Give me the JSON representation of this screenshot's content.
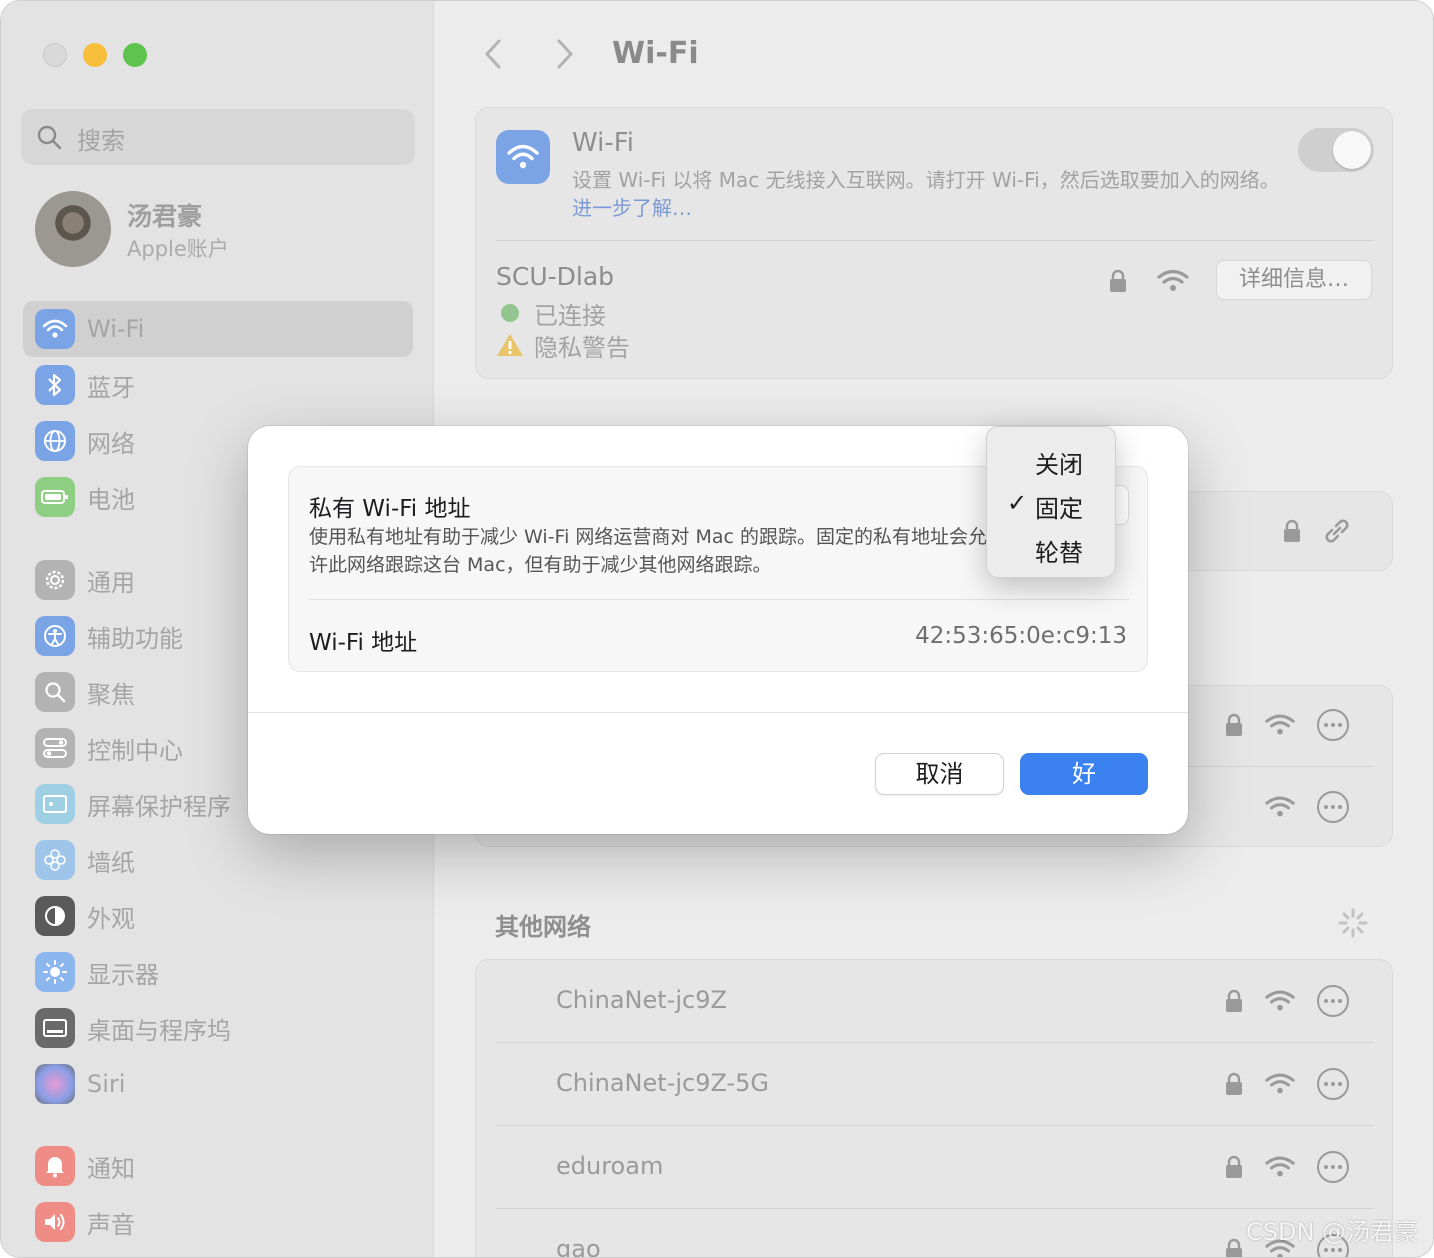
{
  "sidebar": {
    "search_placeholder": "搜索",
    "profile": {
      "name": "汤君豪",
      "sub": "Apple账户"
    },
    "items": [
      {
        "label": "Wi-Fi",
        "icon": "wifi-icon",
        "color": "#7aa4e6",
        "selected": true
      },
      {
        "label": "蓝牙",
        "icon": "bluetooth-icon",
        "color": "#7aa4e6"
      },
      {
        "label": "网络",
        "icon": "globe-icon",
        "color": "#7aa4e6"
      },
      {
        "label": "电池",
        "icon": "battery-icon",
        "color": "#8fcf84"
      },
      {
        "label": "通用",
        "icon": "gear-icon",
        "color": "#b3b3b3"
      },
      {
        "label": "辅助功能",
        "icon": "accessibility-icon",
        "color": "#7aa4e6"
      },
      {
        "label": "聚焦",
        "icon": "spotlight-icon",
        "color": "#b3b3b3"
      },
      {
        "label": "控制中心",
        "icon": "control-center-icon",
        "color": "#b3b3b3"
      },
      {
        "label": "屏幕保护程序",
        "icon": "screensaver-icon",
        "color": "#9fcfe4"
      },
      {
        "label": "墙纸",
        "icon": "wallpaper-icon",
        "color": "#9fc6ea"
      },
      {
        "label": "外观",
        "icon": "appearance-icon",
        "color": "#5a5a5a"
      },
      {
        "label": "显示器",
        "icon": "display-icon",
        "color": "#8bb6ee"
      },
      {
        "label": "桌面与程序坞",
        "icon": "dock-icon",
        "color": "#6a6a6a"
      },
      {
        "label": "Siri",
        "icon": "siri-icon",
        "color": "#a88fd6"
      },
      {
        "label": "通知",
        "icon": "bell-icon",
        "color": "#f08c86"
      },
      {
        "label": "声音",
        "icon": "speaker-icon",
        "color": "#f08c86"
      }
    ]
  },
  "main": {
    "title": "Wi-Fi",
    "wifi_card": {
      "title": "Wi-Fi",
      "desc": "设置 Wi-Fi 以将 Mac 无线接入互联网。请打开 Wi-Fi，然后选取要加入的网络。",
      "link": "进一步了解…"
    },
    "current_network": {
      "name": "SCU-Dlab",
      "status": "已连接",
      "warning": "隐私警告",
      "details_button": "详细信息…"
    },
    "other_networks_title": "其他网络",
    "other_networks": [
      {
        "name": "ChinaNet-jc9Z"
      },
      {
        "name": "ChinaNet-jc9Z-5G"
      },
      {
        "name": "eduroam"
      },
      {
        "name": "gao"
      }
    ]
  },
  "dialog": {
    "title": "私有 Wi-Fi 地址",
    "desc": "使用私有地址有助于减少 Wi-Fi 网络运营商对 Mac 的跟踪。固定的私有地址会允许此网络跟踪这台 Mac，但有助于减少其他网络跟踪。",
    "address_label": "Wi-Fi 地址",
    "address_value": "42:53:65:0e:c9:13",
    "cancel": "取消",
    "ok": "好"
  },
  "menu": {
    "items": [
      "关闭",
      "固定",
      "轮替"
    ],
    "checked": "✓"
  },
  "watermark": "CSDN @汤君豪"
}
